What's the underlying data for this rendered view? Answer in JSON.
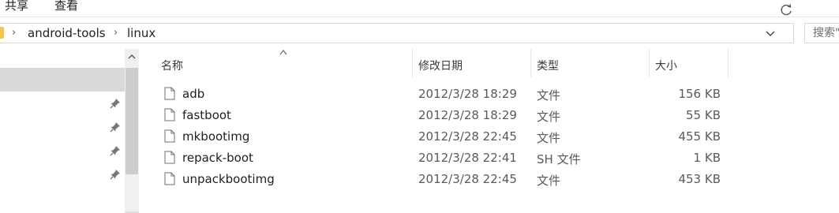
{
  "ribbon": {
    "tabs": [
      "共享",
      "查看"
    ]
  },
  "address_bar": {
    "breadcrumbs": [
      "android-tools",
      "linux"
    ]
  },
  "search": {
    "placeholder": "搜索\"linux\""
  },
  "columns": {
    "name": "名称",
    "date": "修改日期",
    "type": "类型",
    "size": "大小"
  },
  "files": [
    {
      "name": "adb",
      "date": "2012/3/28 18:29",
      "type": "文件",
      "size": "156 KB"
    },
    {
      "name": "fastboot",
      "date": "2012/3/28 18:29",
      "type": "文件",
      "size": "55 KB"
    },
    {
      "name": "mkbootimg",
      "date": "2012/3/28 22:45",
      "type": "文件",
      "size": "455 KB"
    },
    {
      "name": "repack-boot",
      "date": "2012/3/28 22:41",
      "type": "SH 文件",
      "size": "1 KB"
    },
    {
      "name": "unpackbootimg",
      "date": "2012/3/28 22:45",
      "type": "文件",
      "size": "453 KB"
    }
  ],
  "icons": {
    "folder": "folder-icon",
    "pin": "pin-icon",
    "file": "file-icon",
    "refresh": "refresh-icon",
    "dropdown": "chevron-down-icon",
    "sort": "sort-up-icon"
  },
  "colors": {
    "selection": "#d9d9d9",
    "folder": "#f1c64c",
    "scroll_thumb": "#cdcdcd"
  }
}
